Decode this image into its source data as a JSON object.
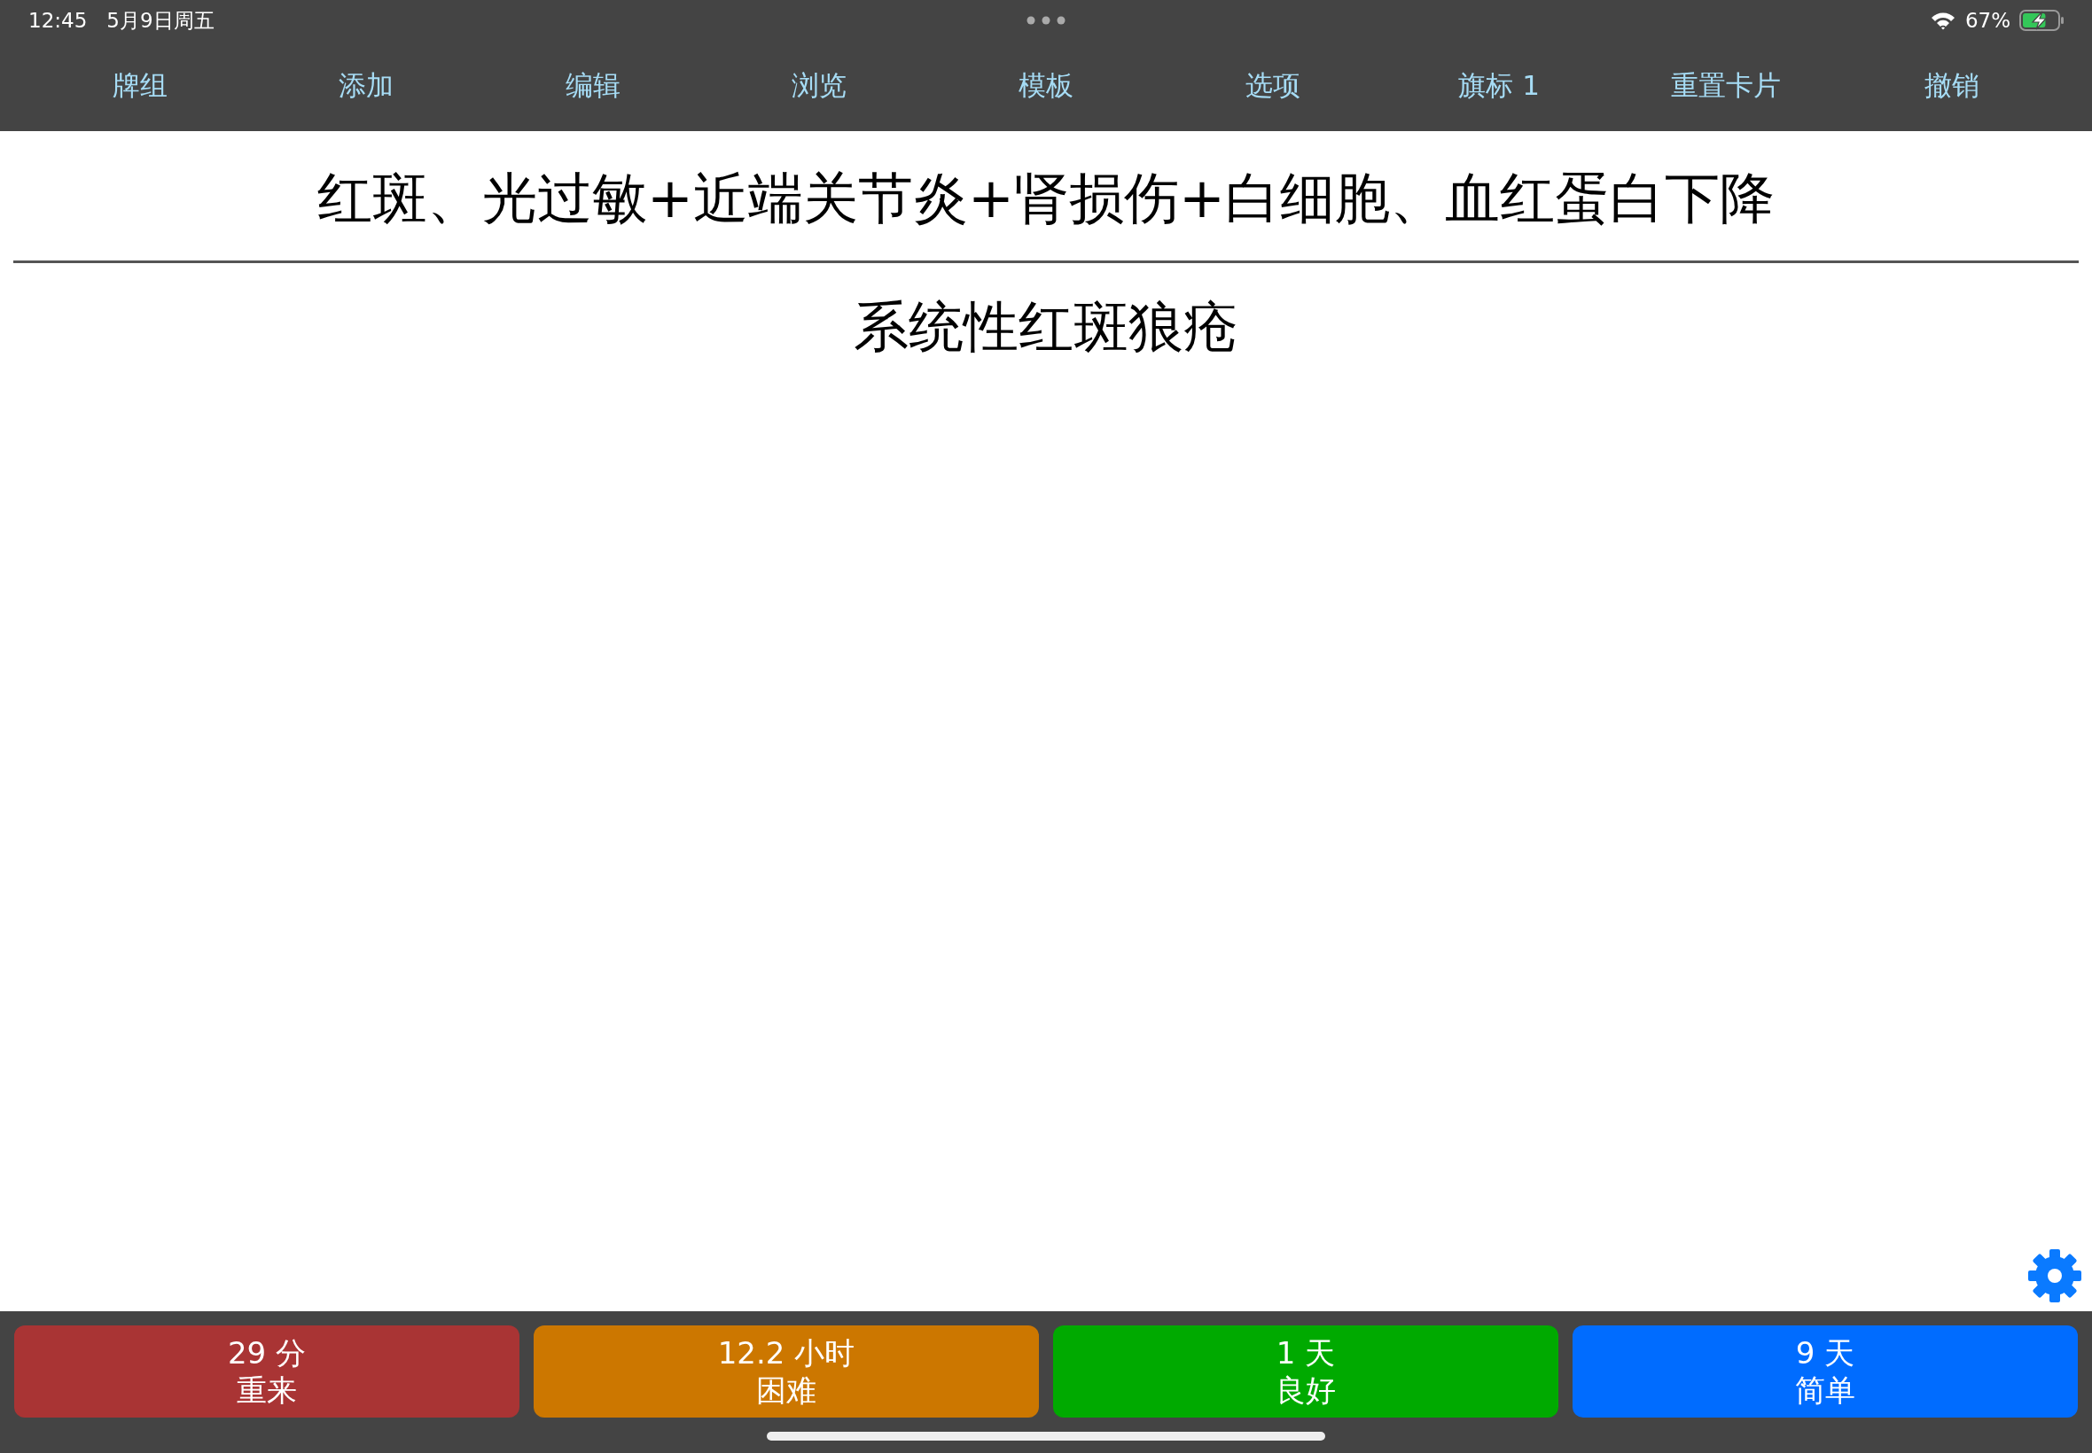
{
  "status_bar": {
    "time": "12:45",
    "date": "5月9日周五",
    "battery_percent": "67%",
    "charging": true,
    "battery": {
      "level": 0.67
    }
  },
  "toolbar": {
    "items": [
      {
        "label": "牌组"
      },
      {
        "label": "添加"
      },
      {
        "label": "编辑"
      },
      {
        "label": "浏览"
      },
      {
        "label": "模板"
      },
      {
        "label": "选项"
      },
      {
        "label": "旗标 1"
      },
      {
        "label": "重置卡片"
      },
      {
        "label": "撤销"
      }
    ]
  },
  "card": {
    "question": "红斑、光过敏+近端关节炎+肾损伤+白细胞、血红蛋白下降",
    "answer": "系统性红斑狼疮"
  },
  "answer_buttons": [
    {
      "interval": "29 分",
      "label": "重来",
      "color": "#a93434"
    },
    {
      "interval": "12.2 小时",
      "label": "困难",
      "color": "#cc7700"
    },
    {
      "interval": "1 天",
      "label": "良好",
      "color": "#00aa00"
    },
    {
      "interval": "9 天",
      "label": "简单",
      "color": "#006cff"
    }
  ]
}
